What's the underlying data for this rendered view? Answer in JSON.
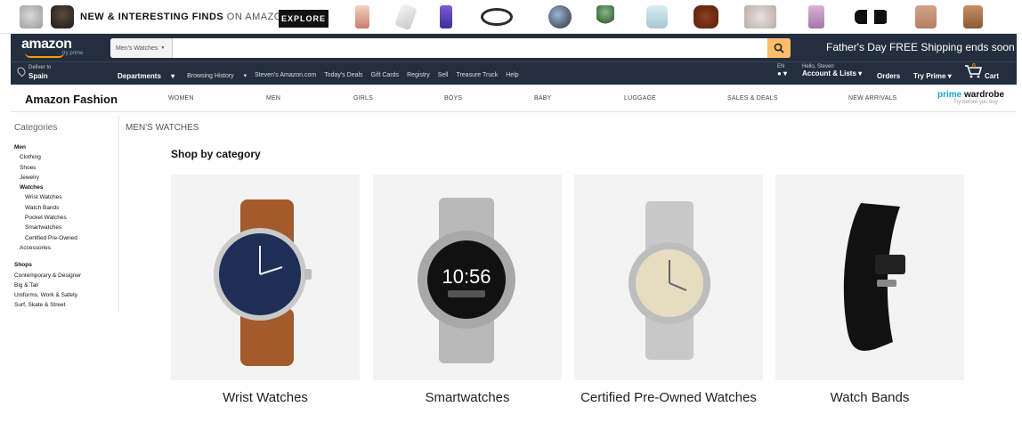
{
  "promo": {
    "text_bold": "NEW & INTERESTING FINDS",
    "text_light": " ON AMAZON",
    "explore": "EXPLORE"
  },
  "header": {
    "logo": "amazon",
    "logo_sub": "try prime",
    "search_scope": "Men's Watches",
    "promo_message": "Father's Day FREE Shipping ends soon",
    "deliver_line1": "Deliver to",
    "deliver_line2": "Spain",
    "departments": "Departments",
    "links": [
      "Browsing History",
      "Steven's Amazon.com",
      "Today's Deals",
      "Gift Cards",
      "Registry",
      "Sell",
      "Treasure Truck",
      "Help"
    ],
    "lang": "EN",
    "greeting": "Hello, Steven",
    "account": "Account & Lists",
    "orders": "Orders",
    "try_prime": "Try Prime",
    "cart": "Cart",
    "cart_count": "0"
  },
  "fashion": {
    "title": "Amazon Fashion",
    "links": [
      "WOMEN",
      "MEN",
      "GIRLS",
      "BOYS",
      "BABY",
      "LUGGAGE",
      "SALES & DEALS",
      "NEW ARRIVALS"
    ],
    "prime": "prime",
    "wardrobe": "wardrobe",
    "tagline": "Try before you buy"
  },
  "sidebar": {
    "title": "Categories",
    "men": "Men",
    "men_items": [
      "Clothing",
      "Shoes",
      "Jewelry"
    ],
    "watches": "Watches",
    "watch_items": [
      "Wrist Watches",
      "Watch Bands",
      "Pocket Watches",
      "Smartwatches",
      "Certified Pre-Owned"
    ],
    "accessories": "Accessories",
    "shops": "Shops",
    "shop_items": [
      "Contemporary & Designer",
      "Big & Tall",
      "Uniforms, Work & Safety",
      "Surf, Skate & Street"
    ]
  },
  "main": {
    "breadcrumb": "MEN'S WATCHES",
    "section_title": "Shop by category",
    "cards": [
      {
        "label": "Wrist Watches"
      },
      {
        "label": "Smartwatches",
        "screen_time": "10:56"
      },
      {
        "label": "Certified Pre-Owned Watches"
      },
      {
        "label": "Watch Bands"
      }
    ]
  },
  "colors": {
    "nav_dark": "#232f3e",
    "search_button": "#febd69",
    "prime_blue": "#1aa4d9",
    "card_bg": "#f3f3f3"
  }
}
